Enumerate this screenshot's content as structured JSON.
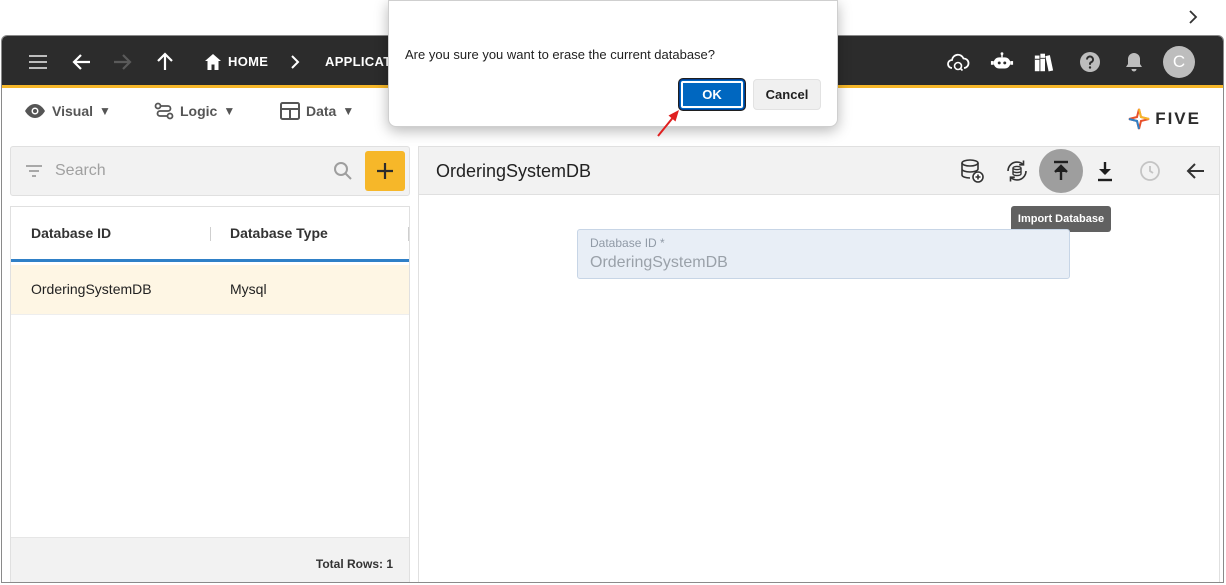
{
  "browser": {
    "icon": "chevron-right-icon"
  },
  "topbar": {
    "icons": [
      "menu-icon",
      "back-arrow-icon",
      "forward-arrow-icon",
      "up-arrow-icon"
    ],
    "home_label": "HOME",
    "applications_label": "APPLICATI",
    "right_icons": [
      "cloud-sync-icon",
      "chatbot-icon",
      "library-icon",
      "help-icon",
      "bell-icon"
    ],
    "avatar_initial": "C"
  },
  "menubar": {
    "visual_label": "Visual",
    "logic_label": "Logic",
    "data_label": "Data",
    "dropdown_glyph": "▼",
    "logo_text": "FIVE"
  },
  "list_panel": {
    "search_placeholder": "Search",
    "columns": [
      "Database ID",
      "Database Type"
    ],
    "rows": [
      {
        "database_id": "OrderingSystemDB",
        "database_type": "Mysql"
      }
    ],
    "total_rows_label": "Total Rows: 1"
  },
  "detail_panel": {
    "title": "OrderingSystemDB",
    "tooltip": "Import Database",
    "field_label": "Database ID *",
    "field_value": "OrderingSystemDB"
  },
  "dialog": {
    "message": "Are you sure you want to erase the current database?",
    "ok_label": "OK",
    "cancel_label": "Cancel"
  },
  "colors": {
    "topbar_bg": "#2c2c2c",
    "accent": "#f6b729",
    "selected_row": "#fef6e4",
    "header_underline": "#2f80c7",
    "ok_button": "#0067c0",
    "annotation_arrow": "#e02020"
  }
}
